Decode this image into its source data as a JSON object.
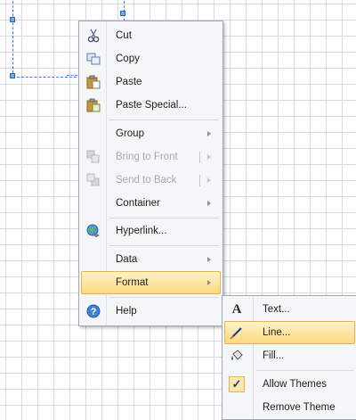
{
  "context_menu": {
    "items": [
      {
        "label": "Cut",
        "icon": "scissors-icon"
      },
      {
        "label": "Copy",
        "icon": "copy-icon"
      },
      {
        "label": "Paste",
        "icon": "paste-icon"
      },
      {
        "label": "Paste Special...",
        "icon": "paste-special-icon"
      },
      {
        "label": "Group"
      },
      {
        "label": "Bring to Front",
        "icon": "bring-to-front-icon"
      },
      {
        "label": "Send to Back",
        "icon": "send-to-back-icon"
      },
      {
        "label": "Container"
      },
      {
        "label": "Hyperlink...",
        "icon": "hyperlink-icon"
      },
      {
        "label": "Data"
      },
      {
        "label": "Format"
      },
      {
        "label": "Help",
        "icon": "help-icon"
      }
    ]
  },
  "format_submenu": {
    "items": [
      {
        "label": "Text...",
        "icon": "text-format-icon"
      },
      {
        "label": "Line...",
        "icon": "line-format-icon"
      },
      {
        "label": "Fill...",
        "icon": "fill-icon"
      },
      {
        "label": "Allow Themes",
        "icon": "checkmark-icon"
      },
      {
        "label": "Remove Theme"
      }
    ]
  },
  "colors": {
    "hover_highlight": "#fbd87d",
    "grid_line": "#d6dbe2",
    "selection_outline": "#3f7fd8"
  }
}
